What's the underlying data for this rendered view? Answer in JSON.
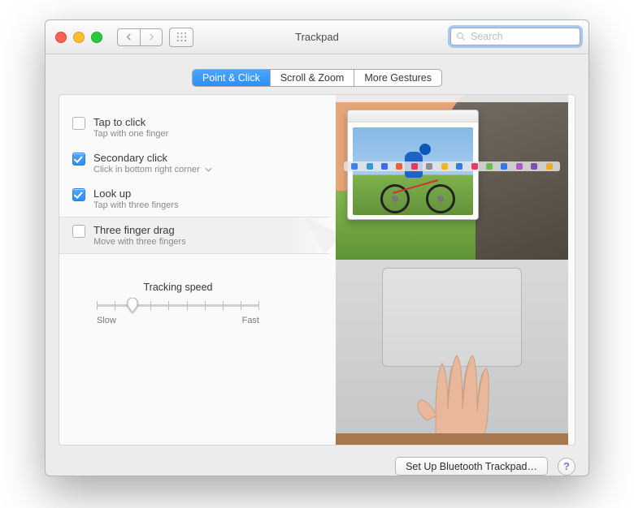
{
  "window": {
    "title": "Trackpad"
  },
  "toolbar": {
    "back_disabled": false,
    "forward_disabled": true
  },
  "search": {
    "placeholder": "Search",
    "value": ""
  },
  "tabs": [
    {
      "label": "Point & Click",
      "active": true
    },
    {
      "label": "Scroll & Zoom",
      "active": false
    },
    {
      "label": "More Gestures",
      "active": false
    }
  ],
  "options": [
    {
      "title": "Tap to click",
      "subtitle": "Tap with one finger",
      "checked": false,
      "has_dropdown": false,
      "highlighted": false
    },
    {
      "title": "Secondary click",
      "subtitle": "Click in bottom right corner",
      "checked": true,
      "has_dropdown": true,
      "highlighted": false
    },
    {
      "title": "Look up",
      "subtitle": "Tap with three fingers",
      "checked": true,
      "has_dropdown": false,
      "highlighted": false
    },
    {
      "title": "Three finger drag",
      "subtitle": "Move with three fingers",
      "checked": false,
      "has_dropdown": false,
      "highlighted": true
    }
  ],
  "slider": {
    "title": "Tracking speed",
    "min_label": "Slow",
    "max_label": "Fast",
    "ticks": 10,
    "value_index": 2
  },
  "dock_colors": [
    "#3a83f0",
    "#2d9cd8",
    "#3a6be8",
    "#ef5e3b",
    "#e23a5f",
    "#8f8f93",
    "#f5b326",
    "#2d7fe0",
    "#e43b6b",
    "#69bf47",
    "#3079e2",
    "#ac59c7",
    "#7e4fae",
    "#efaa2a"
  ],
  "bottom": {
    "bluetooth_button": "Set Up Bluetooth Trackpad…"
  },
  "help": {
    "symbol": "?"
  }
}
